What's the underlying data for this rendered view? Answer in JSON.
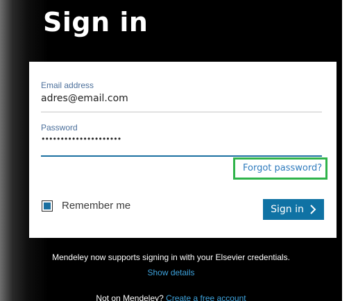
{
  "page": {
    "title": "Sign in"
  },
  "form": {
    "email_label": "Email address",
    "email_value": "adres@email.com",
    "password_label": "Password",
    "password_value": "•••••••••••••••••••••",
    "forgot_password": "Forgot password?",
    "remember_label": "Remember me",
    "remember_checked": true,
    "submit_label": "Sign in"
  },
  "footer": {
    "note": "Mendeley now supports signing in with your Elsevier credentials.",
    "show_details": "Show details",
    "not_on": "Not on Mendeley?",
    "create_account": "Create a free account"
  },
  "colors": {
    "accent": "#0f72a4",
    "link": "#2e7bbd",
    "highlight": "#2fb34a"
  },
  "icons": {
    "submit": "chevron-right-icon"
  }
}
